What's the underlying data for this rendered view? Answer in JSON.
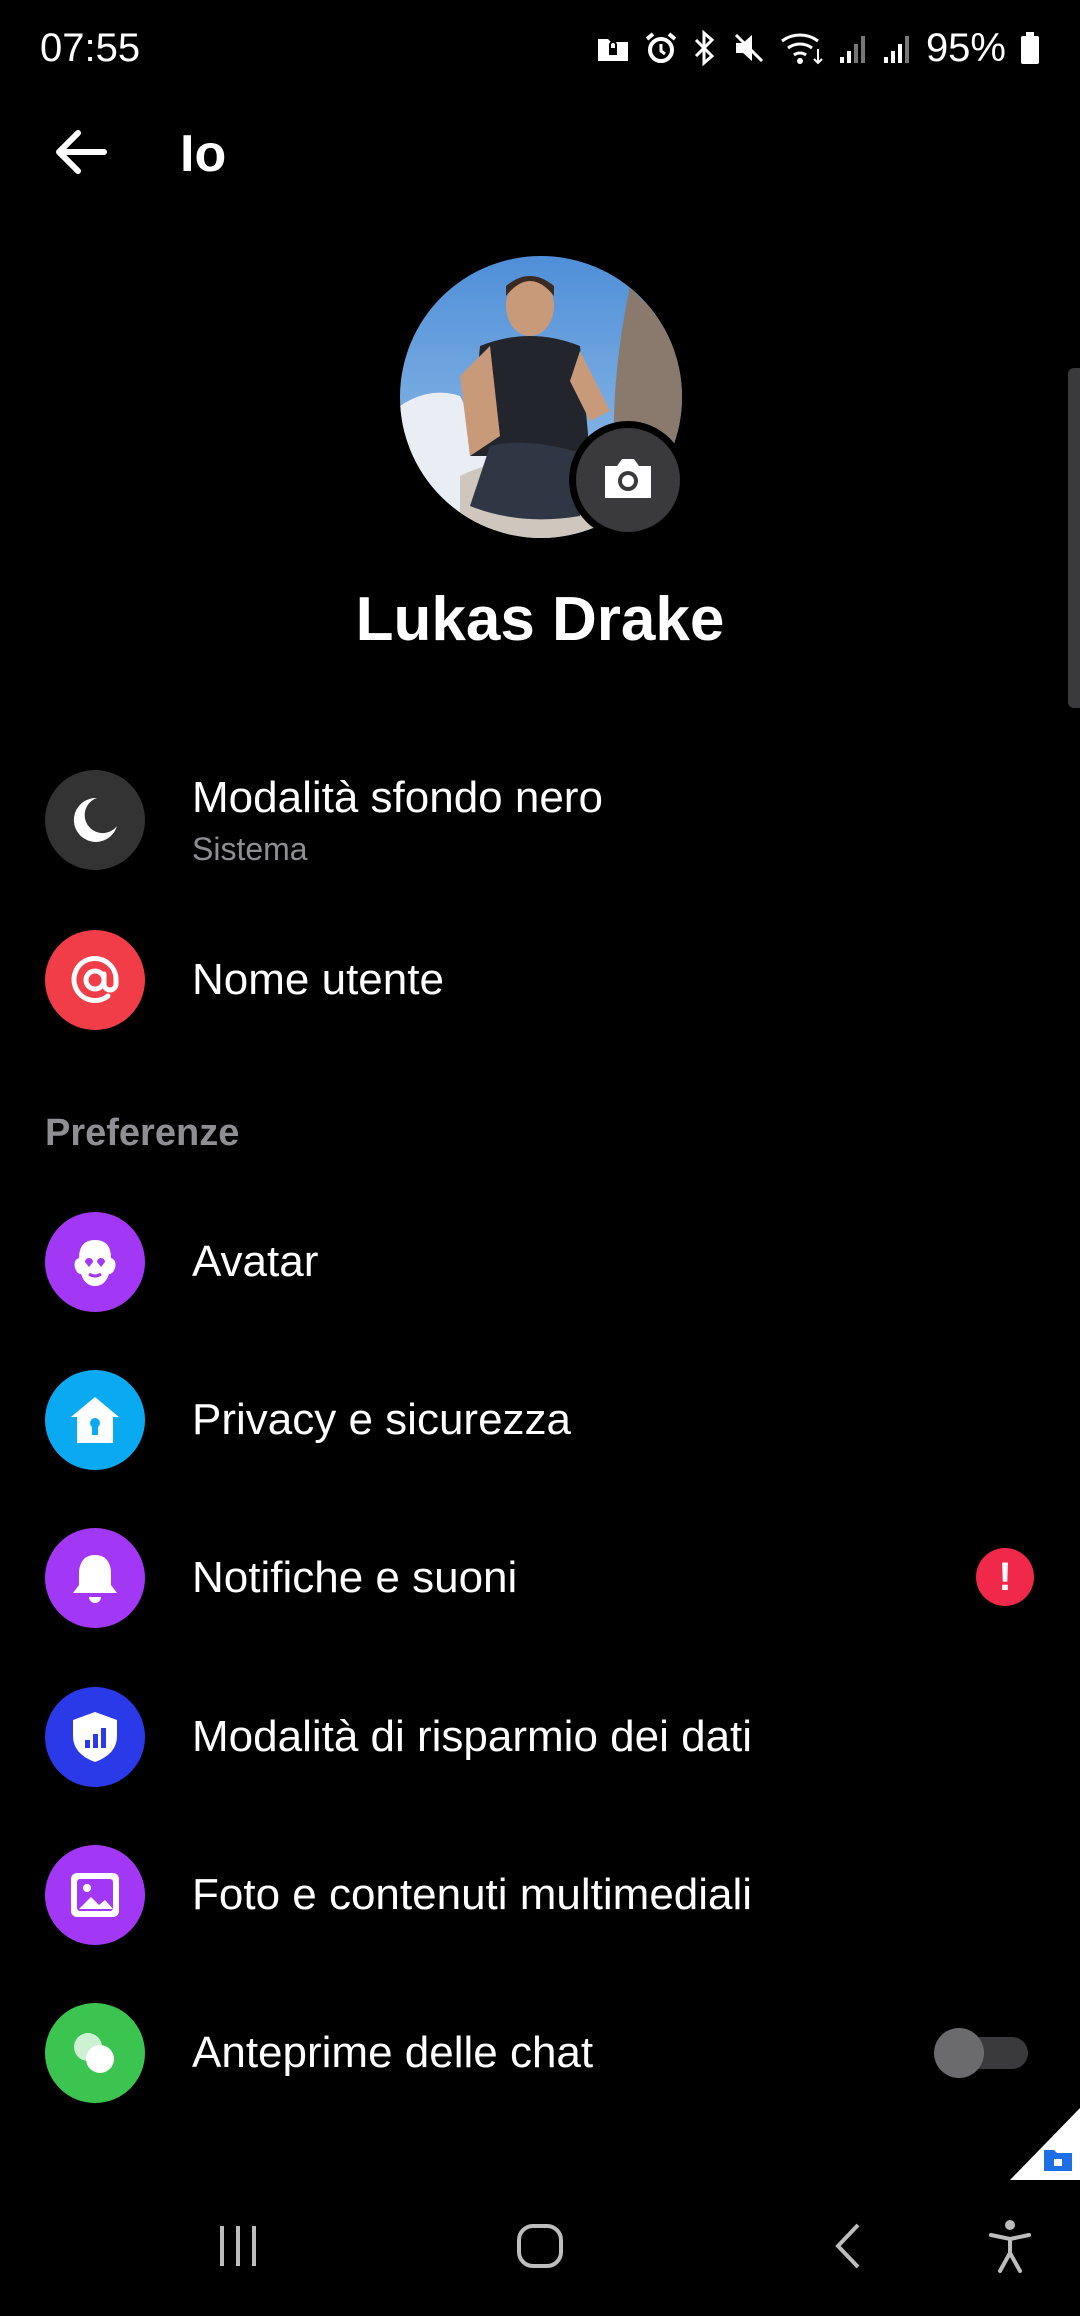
{
  "status_bar": {
    "time": "07:55",
    "battery": "95%",
    "icons": [
      "lock-folder-icon",
      "alarm-icon",
      "bluetooth-icon",
      "mute-icon",
      "wifi-icon",
      "signal-icon",
      "signal-icon",
      "battery-icon"
    ]
  },
  "header": {
    "back_icon": "arrow-left-icon",
    "title": "Io"
  },
  "profile": {
    "name": "Lukas Drake",
    "camera_icon": "camera-icon"
  },
  "account_items": [
    {
      "label": "Modalità sfondo nero",
      "sub": "Sistema",
      "icon": "moon-icon",
      "color": "#333333"
    },
    {
      "label": "Nome utente",
      "icon": "at-icon",
      "color": "#f03d47"
    }
  ],
  "preferences": {
    "section_title": "Preferenze",
    "items": [
      {
        "label": "Avatar",
        "icon": "avatar-face-icon",
        "color": "#a238f6"
      },
      {
        "label": "Privacy e sicurezza",
        "icon": "house-lock-icon",
        "color": "#0aaaf3"
      },
      {
        "label": "Notifiche e suoni",
        "icon": "bell-icon",
        "color": "#a238f6",
        "badge": "!"
      },
      {
        "label": "Modalità di risparmio dei dati",
        "icon": "shield-signal-icon",
        "color": "#2a3ae8"
      },
      {
        "label": "Foto e contenuti multimediali",
        "icon": "photo-icon",
        "color": "#a238f6"
      },
      {
        "label": "Anteprime delle chat",
        "icon": "chat-bubbles-icon",
        "color": "#3cc450",
        "toggle": false
      }
    ]
  },
  "nav_bar": {
    "icons": [
      "recents-icon",
      "home-icon",
      "back-icon",
      "accessibility-icon"
    ]
  }
}
